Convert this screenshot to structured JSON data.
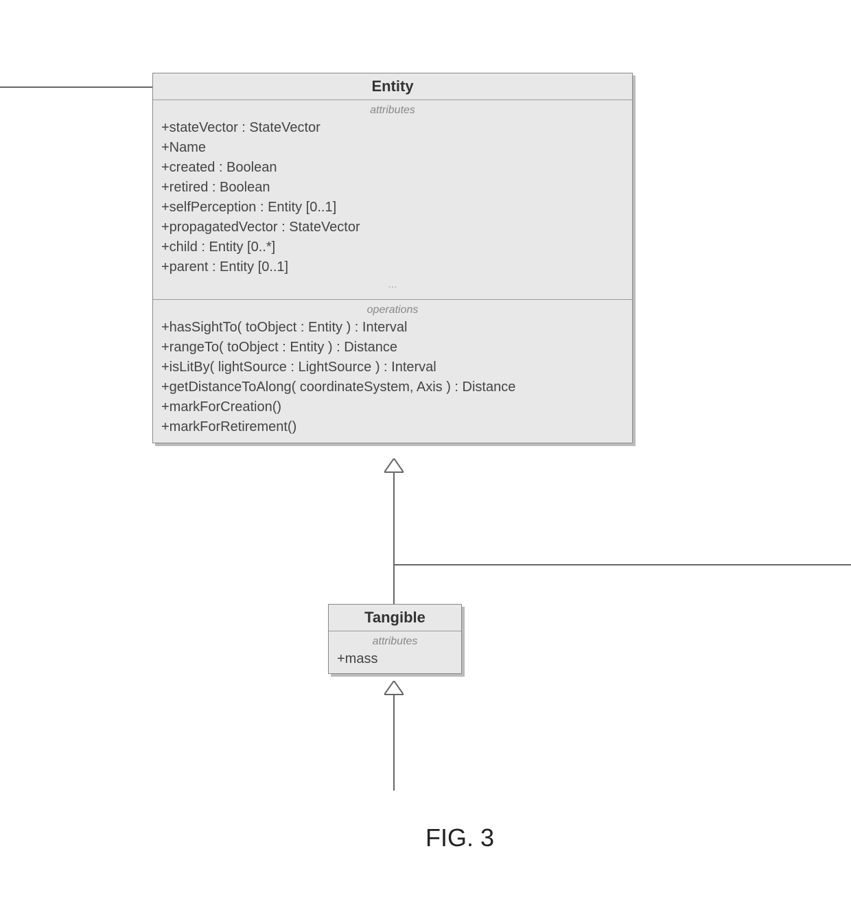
{
  "figure_label": "FIG. 3",
  "entity": {
    "title": "Entity",
    "attributes_label": "attributes",
    "operations_label": "operations",
    "attributes": [
      "+stateVector : StateVector",
      "+Name",
      "+created : Boolean",
      "+retired : Boolean",
      "+selfPerception : Entity [0..1]",
      "+propagatedVector : StateVector",
      "+child : Entity [0..*]",
      "+parent : Entity [0..1]"
    ],
    "operations": [
      "+hasSightTo( toObject : Entity ) : Interval",
      "+rangeTo( toObject : Entity ) : Distance",
      "+isLitBy( lightSource : LightSource ) : Interval",
      "+getDistanceToAlong( coordinateSystem, Axis ) : Distance",
      "+markForCreation()",
      "+markForRetirement()"
    ]
  },
  "tangible": {
    "title": "Tangible",
    "attributes_label": "attributes",
    "attributes": [
      "+mass"
    ]
  }
}
